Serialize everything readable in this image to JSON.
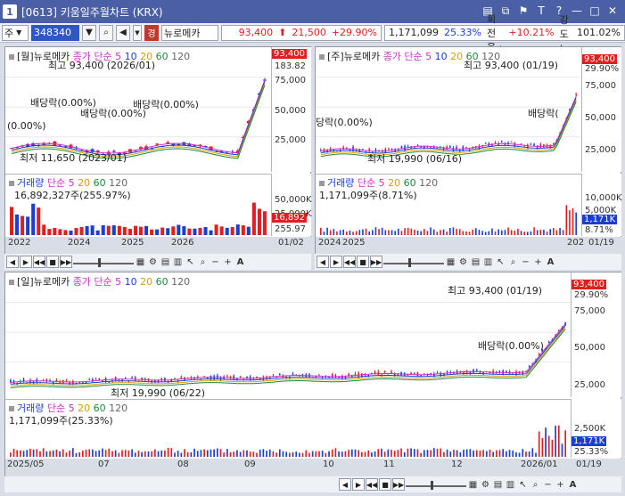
{
  "window": {
    "screen_num": "1",
    "title": "[0613] 키움일주월차트 (KRX)",
    "icons": [
      "window-list-icon",
      "copy-icon",
      "pin-icon",
      "text-t-icon",
      "help-icon",
      "minimize-icon",
      "maximize-icon",
      "close-icon"
    ]
  },
  "toolbar": {
    "market_select": "주",
    "stock_code": "348340",
    "market_badge": "경",
    "stock_name": "뉴로메카",
    "price": "93,400",
    "change": "21,500",
    "change_pct": "+29.90%",
    "volume": "1,171,099",
    "volume_pct": "25.33%",
    "turnover_label": "회전율 :",
    "turnover": "+10.21%",
    "strength_label": "강도 :",
    "strength": "101.02%"
  },
  "charts": {
    "monthly": {
      "title": "[월]뉴로메카",
      "ma_prefix": "종가 단순",
      "ma": [
        "5",
        "10",
        "20",
        "60",
        "120"
      ],
      "ma_colors": [
        "#cc33cc",
        "#1a3fd0",
        "#d8a000",
        "#1e8a3a",
        "#666666"
      ],
      "high_note": "최고 93,400 (2026/01)",
      "low_note": "최저 11,650 (2023/01)",
      "dividend_notes": [
        "배당락(0.00%)",
        "배당락(0.00%)",
        "배당락(0.00%)",
        "(0.00%)"
      ],
      "y_ticks": [
        "75,000",
        "50,000",
        "25,000"
      ],
      "top_vals": [
        "93,400",
        "183.82"
      ],
      "vol_title": "거래량",
      "vol_ma_prefix": "단순",
      "vol_ma": [
        "5",
        "20",
        "60",
        "120"
      ],
      "vol_value": "16,892,327주(255.97%)",
      "vol_ticks": [
        "50,000K",
        "25,000K"
      ],
      "vol_tag": "16,892",
      "vol_pct": "255.97",
      "dates": [
        "2022",
        "2024",
        "2025",
        "2026"
      ],
      "last_date": "01/02"
    },
    "weekly": {
      "title": "[주]뉴로메카",
      "ma_prefix": "종가 단순",
      "ma": [
        "5",
        "10",
        "20",
        "60",
        "120"
      ],
      "high_note": "최고 93,400 (01/19)",
      "low_note": "최저 19,990 (06/16)",
      "dividend_notes": [
        "당락(0.00%)",
        "배당락("
      ],
      "y_ticks": [
        "75,000",
        "50,000",
        "25,000"
      ],
      "top_tag": "93,400",
      "top_pct": "29.90%",
      "vol_title": "거래량",
      "vol_ma_prefix": "단순",
      "vol_ma": [
        "5",
        "20",
        "60",
        "120"
      ],
      "vol_value": "1,171,099주(8.71%)",
      "vol_ticks": [
        "10,000K",
        "5,000K"
      ],
      "vol_tag": "1,171K",
      "vol_pct": "8.71%",
      "dates": [
        "2024",
        "2025",
        "202"
      ],
      "last_date": "01/19"
    },
    "daily": {
      "title": "[일]뉴로메카",
      "ma_prefix": "종가 단순",
      "ma": [
        "5",
        "10",
        "20",
        "60",
        "120"
      ],
      "high_note": "최고 93,400 (01/19)",
      "low_note": "최저 19,990 (06/22)",
      "dividend_note": "배당락(0.00%)",
      "y_ticks": [
        "75,000",
        "50,000",
        "25,000"
      ],
      "top_tag": "93,400",
      "top_pct": "29.90%",
      "vol_title": "거래량",
      "vol_ma_prefix": "단순",
      "vol_ma": [
        "5",
        "20",
        "60",
        "120"
      ],
      "vol_value": "1,171,099주(25.33%)",
      "vol_ticks": [
        "2,500K"
      ],
      "vol_tag": "1,171K",
      "vol_pct": "25.33%",
      "dates": [
        "2025/05",
        "07",
        "08",
        "09",
        "10",
        "11",
        "12",
        "2026/01"
      ],
      "last_date": "01/19"
    }
  },
  "controls": {
    "nav_buttons": [
      "◀",
      "▶",
      "◀◀",
      "■",
      "▶▶"
    ],
    "tool_icons": [
      "grid-icon",
      "settings-icon",
      "chart-type-icon",
      "cursor-icon",
      "zoom-icon",
      "minus-icon",
      "plus-icon",
      "font-icon"
    ],
    "minus": "−",
    "plus": "+",
    "font": "A"
  }
}
